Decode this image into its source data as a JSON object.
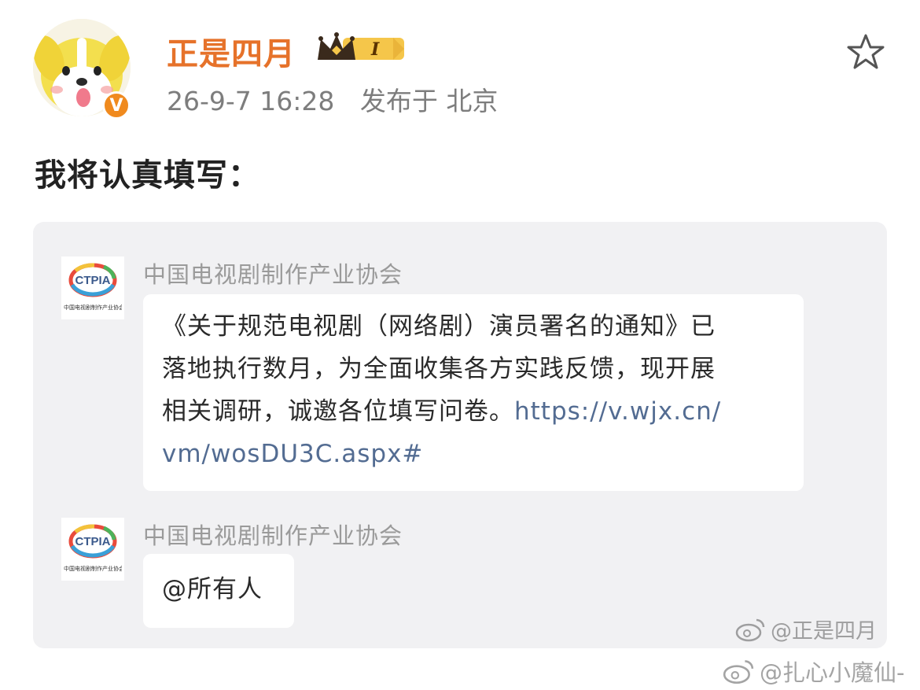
{
  "post": {
    "username": "正是四月",
    "rank_badge": "I",
    "time": "26-9-7 16:28",
    "location": "发布于 北京",
    "verified_mark": "V",
    "text": "我将认真填写："
  },
  "quoted_chat": {
    "messages": [
      {
        "sender": "中国电视剧制作产业协会",
        "logo_text": "CTPIA",
        "logo_subtitle": "中国电视剧制作产业协会",
        "lines": [
          "《关于规范电视剧（网络剧）演员署名的通知》已",
          "落地执行数月，为全面收集各方实践反馈，现开展",
          "相关调研，诚邀各位填写问卷。"
        ],
        "link_part1": "https://v.wjx.cn/",
        "link_part2": "vm/wosDU3C.aspx#"
      },
      {
        "sender": "中国电视剧制作产业协会",
        "logo_text": "CTPIA",
        "logo_subtitle": "中国电视剧制作产业协会",
        "text": "@所有人"
      }
    ]
  },
  "watermarks": {
    "first": "@正是四月",
    "second": "@扎心小魔仙-"
  },
  "colors": {
    "username": "#e6722a",
    "link": "#536c92",
    "card_background": "#f1f1f3",
    "verified": "#f08a1e"
  },
  "icons": [
    "dog-avatar-icon",
    "crown-icon",
    "verified-badge-icon",
    "star-icon",
    "weibo-icon"
  ]
}
